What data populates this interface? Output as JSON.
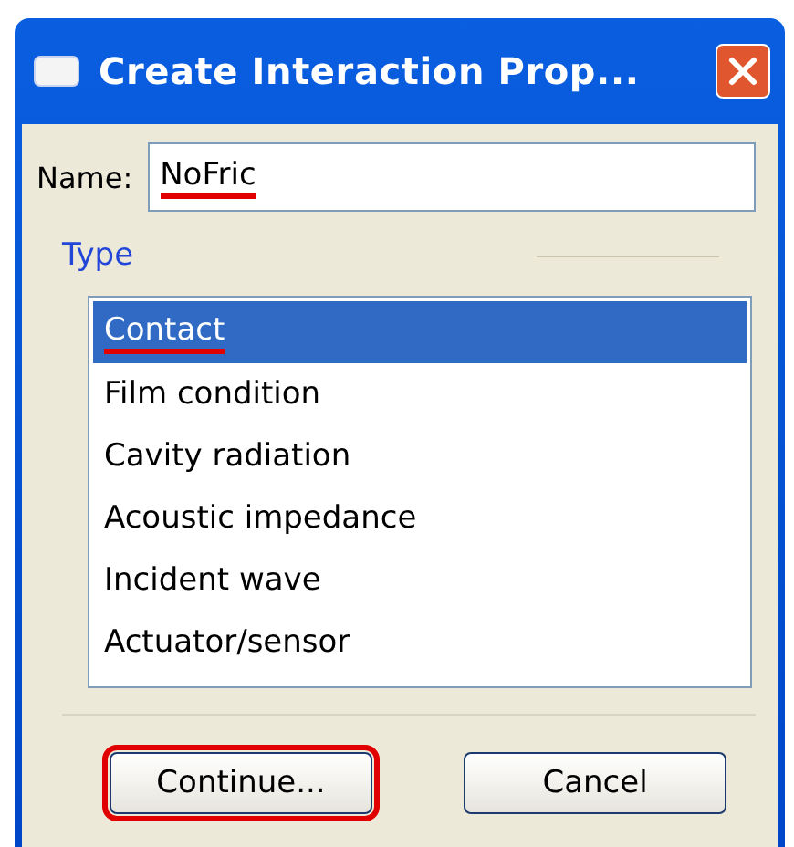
{
  "window": {
    "title": "Create Interaction Prop..."
  },
  "name_field": {
    "label": "Name:",
    "value": "NoFric",
    "underlined": true
  },
  "type_group": {
    "label": "Type",
    "items": [
      {
        "label": "Contact",
        "selected": true,
        "underlined": true
      },
      {
        "label": "Film condition",
        "selected": false,
        "underlined": false
      },
      {
        "label": "Cavity radiation",
        "selected": false,
        "underlined": false
      },
      {
        "label": "Acoustic impedance",
        "selected": false,
        "underlined": false
      },
      {
        "label": "Incident wave",
        "selected": false,
        "underlined": false
      },
      {
        "label": "Actuator/sensor",
        "selected": false,
        "underlined": false
      }
    ]
  },
  "buttons": [
    {
      "label": "Continue...",
      "highlighted": true
    },
    {
      "label": "Cancel",
      "highlighted": false
    }
  ]
}
